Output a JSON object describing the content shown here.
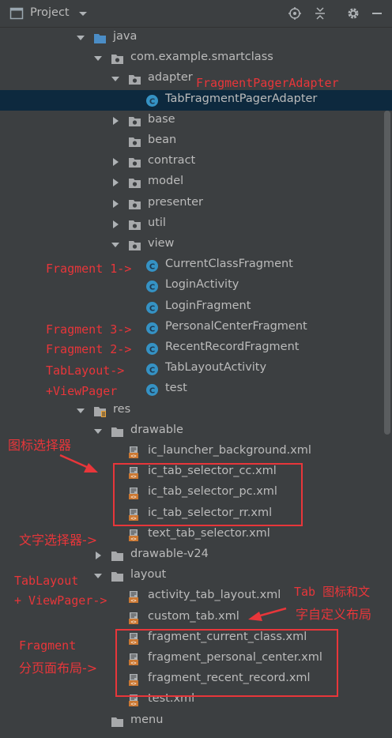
{
  "toolbar": {
    "title": "Project"
  },
  "tree": [
    {
      "label": "java",
      "type": "folder-blue",
      "expand": "down",
      "indent": 0
    },
    {
      "label": "com.example.smartclass",
      "type": "package",
      "expand": "down",
      "indent": 1
    },
    {
      "label": "adapter",
      "type": "package",
      "expand": "down",
      "indent": 2
    },
    {
      "label": "TabFragmentPagerAdapter",
      "type": "class",
      "expand": "none",
      "indent": 3,
      "selected": true
    },
    {
      "label": "base",
      "type": "package",
      "expand": "right",
      "indent": 2
    },
    {
      "label": "bean",
      "type": "package",
      "expand": "none",
      "indent": 2
    },
    {
      "label": "contract",
      "type": "package",
      "expand": "right",
      "indent": 2
    },
    {
      "label": "model",
      "type": "package",
      "expand": "right",
      "indent": 2
    },
    {
      "label": "presenter",
      "type": "package",
      "expand": "right",
      "indent": 2
    },
    {
      "label": "util",
      "type": "package",
      "expand": "right",
      "indent": 2
    },
    {
      "label": "view",
      "type": "package",
      "expand": "down",
      "indent": 2
    },
    {
      "label": "CurrentClassFragment",
      "type": "class",
      "expand": "none",
      "indent": 3
    },
    {
      "label": "LoginActivity",
      "type": "class",
      "expand": "none",
      "indent": 3
    },
    {
      "label": "LoginFragment",
      "type": "class",
      "expand": "none",
      "indent": 3
    },
    {
      "label": "PersonalCenterFragment",
      "type": "class",
      "expand": "none",
      "indent": 3
    },
    {
      "label": "RecentRecordFragment",
      "type": "class",
      "expand": "none",
      "indent": 3
    },
    {
      "label": "TabLayoutActivity",
      "type": "class",
      "expand": "none",
      "indent": 3
    },
    {
      "label": "test",
      "type": "class",
      "expand": "none",
      "indent": 3
    },
    {
      "label": "res",
      "type": "res",
      "expand": "down",
      "indent": 0
    },
    {
      "label": "drawable",
      "type": "folder",
      "expand": "down",
      "indent": 1
    },
    {
      "label": "ic_launcher_background.xml",
      "type": "xml",
      "expand": "none",
      "indent": 2
    },
    {
      "label": "ic_tab_selector_cc.xml",
      "type": "xml",
      "expand": "none",
      "indent": 2
    },
    {
      "label": "ic_tab_selector_pc.xml",
      "type": "xml",
      "expand": "none",
      "indent": 2
    },
    {
      "label": "ic_tab_selector_rr.xml",
      "type": "xml",
      "expand": "none",
      "indent": 2
    },
    {
      "label": "text_tab_selector.xml",
      "type": "xml",
      "expand": "none",
      "indent": 2
    },
    {
      "label": "drawable-v24",
      "type": "folder",
      "expand": "right",
      "indent": 1
    },
    {
      "label": "layout",
      "type": "folder",
      "expand": "down",
      "indent": 1
    },
    {
      "label": "activity_tab_layout.xml",
      "type": "xml",
      "expand": "none",
      "indent": 2
    },
    {
      "label": "custom_tab.xml",
      "type": "xml",
      "expand": "none",
      "indent": 2
    },
    {
      "label": "fragment_current_class.xml",
      "type": "xml",
      "expand": "none",
      "indent": 2
    },
    {
      "label": "fragment_personal_center.xml",
      "type": "xml",
      "expand": "none",
      "indent": 2
    },
    {
      "label": "fragment_recent_record.xml",
      "type": "xml",
      "expand": "none",
      "indent": 2
    },
    {
      "label": "test.xml",
      "type": "xml",
      "expand": "none",
      "indent": 2
    },
    {
      "label": "menu",
      "type": "folder",
      "expand": "none",
      "indent": 1
    }
  ],
  "annotations": {
    "adapter": "FragmentPagerAdapter",
    "fragment1": "Fragment 1->",
    "fragment3": "Fragment 3->",
    "fragment2": "Fragment 2->",
    "tablayout1": "TabLayout->",
    "tablayout2": "+ViewPager",
    "icon_selector": "图标选择器",
    "text_selector": "文字选择器->",
    "tl_vp1": "TabLayout",
    "tl_vp2": "+ ViewPager->",
    "tab_custom1": "Tab 图标和文",
    "tab_custom2": "字自定义布局",
    "frag_layout1": "Fragment",
    "frag_layout2": "分页面布局->"
  },
  "colors": {
    "annotation": "#e8363a",
    "selection": "#0d293e",
    "class_icon": "#3592c4",
    "xml_icon": "#cc7832"
  }
}
